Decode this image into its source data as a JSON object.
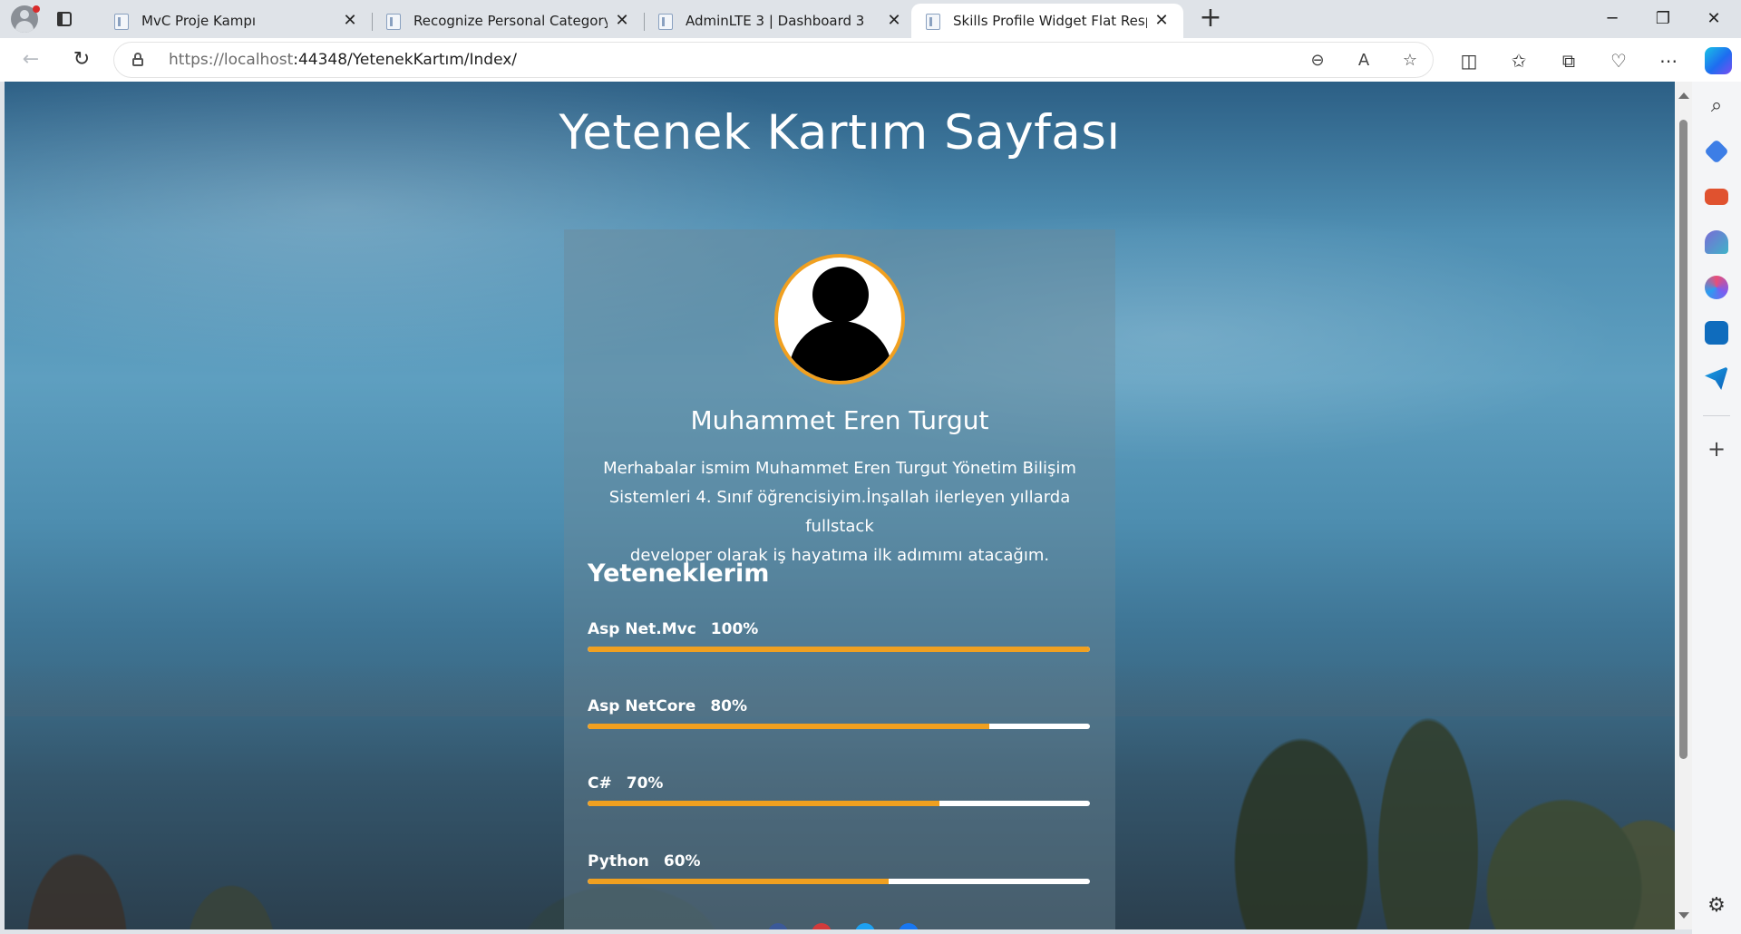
{
  "browser": {
    "tabs": [
      {
        "title": "MvC Proje Kampı",
        "active": false
      },
      {
        "title": "Recognize Personal Category Box",
        "active": false
      },
      {
        "title": "AdminLTE 3 | Dashboard 3",
        "active": false
      },
      {
        "title": "Skills Profile Widget Flat Responsive",
        "active": true
      }
    ],
    "tab_close_glyph": "✕",
    "new_tab_glyph": "+",
    "url_host": "https://localhost",
    "url_rest": ":44348/YetenekKartım/Index/",
    "window_controls": {
      "minimize": "─",
      "restore": "❐",
      "close": "✕"
    },
    "toolbar_icons": [
      "back-icon",
      "refresh-icon",
      "lock-icon",
      "zoom-out-icon",
      "read-aloud-icon",
      "favorite-star-icon",
      "split-screen-icon",
      "favorites-icon",
      "collections-icon",
      "browser-essentials-icon",
      "more-icon",
      "copilot-icon"
    ],
    "sidebar_icons": [
      "search-icon",
      "shopping-tag-icon",
      "tools-icon",
      "games-icon",
      "office-icon",
      "outlook-icon",
      "send-icon",
      "add-icon",
      "settings-icon"
    ],
    "accent": "#f0a020"
  },
  "page": {
    "title": "Yetenek Kartım Sayfası",
    "profile": {
      "name": "Muhammet Eren Turgut",
      "bio_line1": "Merhabalar ismim Muhammet Eren Turgut Yönetim Bilişim",
      "bio_line2": "Sistemleri 4. Sınıf öğrencisiyim.İnşallah ilerleyen yıllarda fullstack",
      "bio_line3": "developer olarak iş hayatıma ilk adımımı atacağım."
    },
    "skills_title": "Yeteneklerim",
    "skills": [
      {
        "name": "Asp Net.Mvc",
        "percent_label": "100%",
        "percent": 100
      },
      {
        "name": "Asp NetCore",
        "percent_label": "80%",
        "percent": 80
      },
      {
        "name": "C#",
        "percent_label": "70%",
        "percent": 70
      },
      {
        "name": "Python",
        "percent_label": "60%",
        "percent": 60
      }
    ]
  }
}
